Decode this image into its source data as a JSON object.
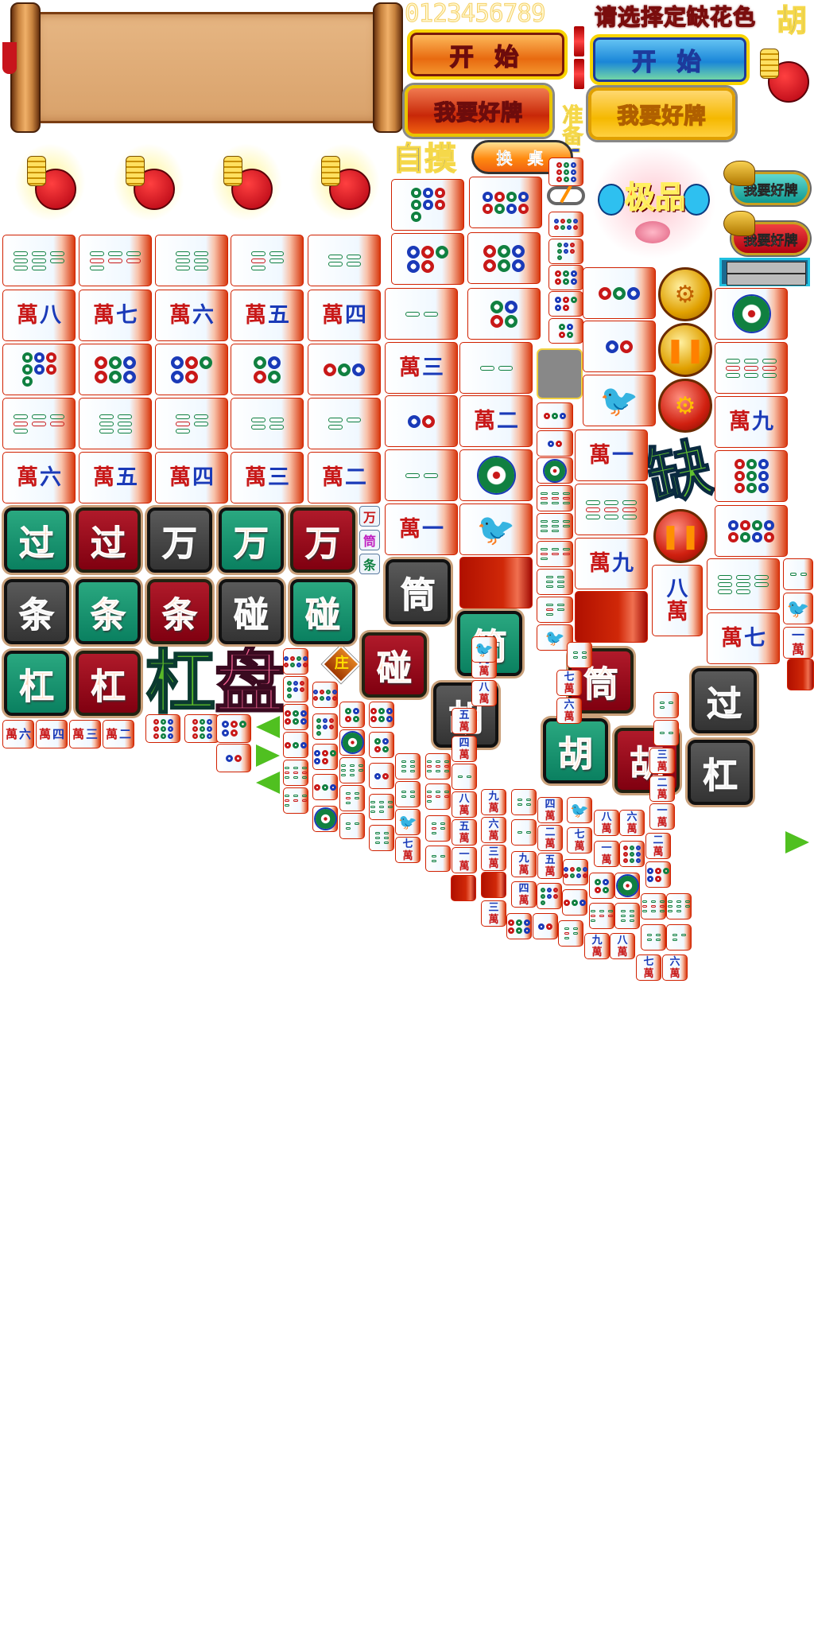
{
  "digits": "0123456789",
  "banner": "请选择定缺花色",
  "hu_label": "胡",
  "buttons": {
    "start_orange": "开 始",
    "start_blue": "开 始",
    "want_good_red": "我要好牌",
    "want_good_gold": "我要好牌",
    "ready": "准备!",
    "zimo": "自摸",
    "swap_table": "换 桌",
    "dragon_teal": "我要好牌",
    "dragon_red": "我要好牌",
    "jipin": "极品"
  },
  "colors": {
    "green": "#0a8060",
    "red": "#800010",
    "gray": "#333333",
    "accent": "#f8d400"
  },
  "wan_numerals": [
    "一",
    "二",
    "三",
    "四",
    "五",
    "六",
    "七",
    "八",
    "九"
  ],
  "wan_char": "萬",
  "actions": [
    {
      "label": "过",
      "style": "green"
    },
    {
      "label": "过",
      "style": "red"
    },
    {
      "label": "万",
      "style": "gray"
    },
    {
      "label": "万",
      "style": "green"
    },
    {
      "label": "万",
      "style": "red"
    },
    {
      "label": "条",
      "style": "gray"
    },
    {
      "label": "条",
      "style": "green"
    },
    {
      "label": "条",
      "style": "red"
    },
    {
      "label": "碰",
      "style": "gray"
    },
    {
      "label": "碰",
      "style": "green"
    },
    {
      "label": "杠",
      "style": "green"
    },
    {
      "label": "杠",
      "style": "red"
    },
    {
      "label": "筒",
      "style": "gray"
    },
    {
      "label": "碰",
      "style": "red"
    },
    {
      "label": "筒",
      "style": "green"
    },
    {
      "label": "胡",
      "style": "gray"
    },
    {
      "label": "筒",
      "style": "red"
    },
    {
      "label": "胡",
      "style": "green"
    },
    {
      "label": "胡",
      "style": "red"
    },
    {
      "label": "过",
      "style": "gray"
    },
    {
      "label": "杠",
      "style": "gray"
    }
  ],
  "suit_buttons": [
    {
      "label": "万",
      "color": "#c81818"
    },
    {
      "label": "筒",
      "color": "#c020c0"
    },
    {
      "label": "条",
      "color": "#108040"
    }
  ],
  "big_text": {
    "gang": "杠",
    "pan": "盘",
    "que": "缺"
  },
  "zhuang": "庄",
  "tile_groups": {
    "grid": [
      "t8",
      "t7",
      "t6",
      "t5",
      "t4",
      "w8",
      "w7",
      "w6",
      "w5",
      "w4",
      "d7",
      "d6",
      "d5",
      "d4",
      "d3",
      "t7",
      "t6",
      "t5",
      "t4",
      "t3",
      "w6",
      "w5",
      "w4",
      "w3",
      "w2"
    ],
    "col_a": [
      "d7",
      "d5",
      "t2",
      "w3",
      "d2",
      "t2",
      "w1"
    ],
    "col_b": [
      "d8",
      "d6",
      "d4",
      "t2",
      "w2",
      "f1",
      "b1",
      "back"
    ],
    "col_c": [
      "d9",
      "d8",
      "d7",
      "d6",
      "d5",
      "d4",
      "blank",
      "d3",
      "d2",
      "f1",
      "t9",
      "t8",
      "t7",
      "t6",
      "t5",
      "b1"
    ],
    "col_d": [
      "d3",
      "d2",
      "b1",
      "w1",
      "t9",
      "w9",
      "back"
    ],
    "col_f": [
      "f1",
      "t9",
      "w9",
      "d9",
      "d8",
      "t8",
      "w7",
      "w8"
    ],
    "right_small": [
      "t2",
      "b1",
      "w1",
      "back"
    ],
    "bottom_left": [
      "w6",
      "w4",
      "w3",
      "w2"
    ],
    "mid_small": [
      "d9",
      "d9",
      "d5",
      "d2"
    ],
    "triangle": [
      "d8",
      "d7",
      "d6",
      "d3",
      "t9",
      "t7",
      "d8",
      "d7",
      "d5",
      "d3",
      "f1",
      "d4",
      "f1",
      "t8",
      "t5",
      "t3",
      "d6",
      "d4",
      "d2",
      "t8",
      "t6",
      "t6",
      "t4",
      "b1",
      "w7",
      "t9",
      "t7",
      "t5",
      "t3",
      "w5",
      "w4",
      "t2",
      "w8",
      "w5",
      "w1",
      "back",
      "w9",
      "w8",
      "b1",
      "w9",
      "w6",
      "w3",
      "back",
      "w3",
      "t4",
      "t2",
      "w9",
      "w4",
      "d6",
      "w4",
      "w2",
      "w5",
      "d7",
      "d2",
      "t4",
      "w7",
      "w6",
      "b1",
      "w7",
      "d8",
      "d3",
      "t5",
      "w8",
      "w1",
      "d4",
      "t7",
      "w9",
      "w6",
      "d9",
      "f1",
      "t6",
      "w8",
      "t3",
      "t2",
      "w3",
      "w2",
      "w1",
      "w2",
      "d5",
      "t9",
      "t4",
      "w7",
      "t8",
      "t3",
      "w6"
    ]
  }
}
